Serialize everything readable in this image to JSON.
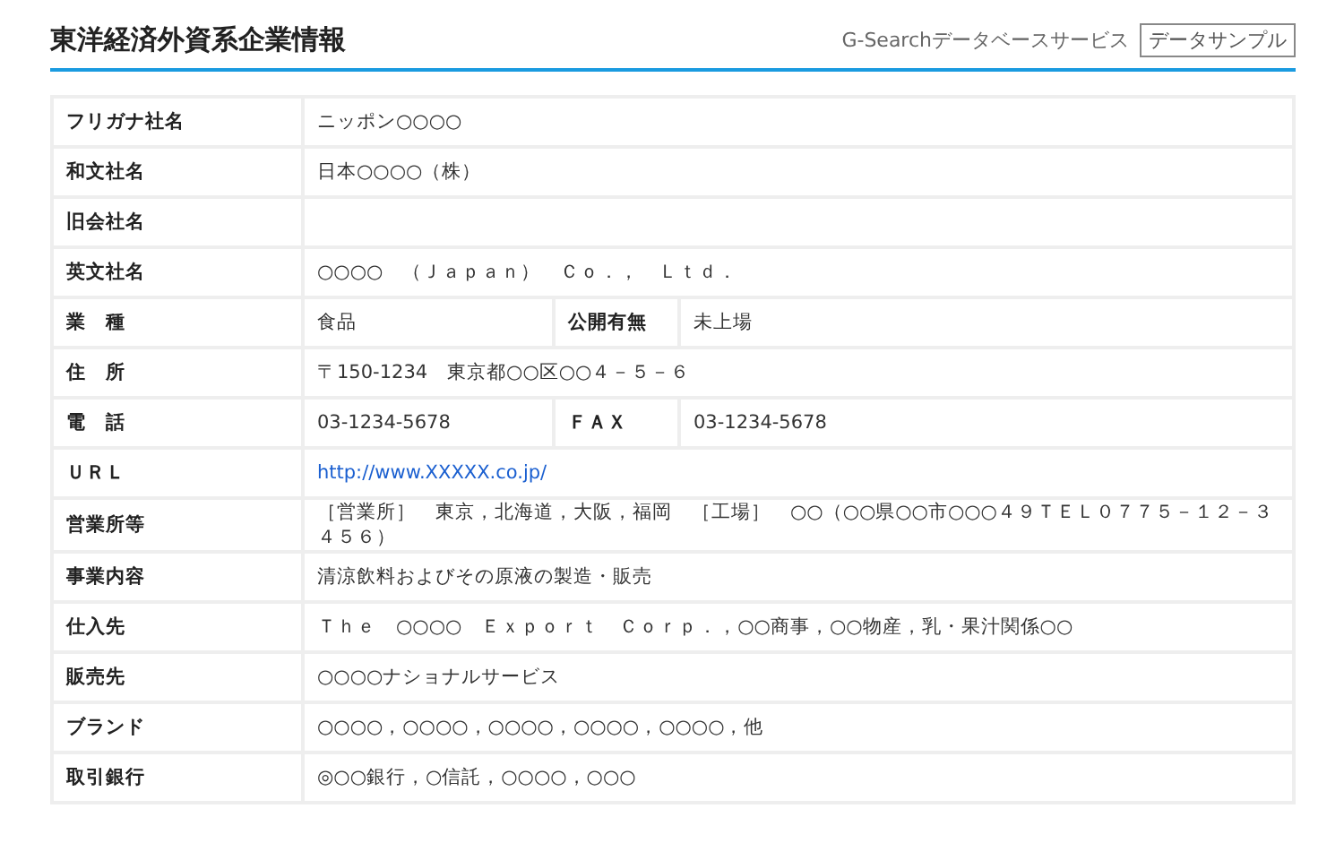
{
  "header": {
    "title": "東洋経済外資系企業情報",
    "service": "G-Searchデータベースサービス",
    "badge": "データサンプル"
  },
  "rows": [
    {
      "kind": "single",
      "label": "フリガナ社名",
      "value": "ニッポン○○○○"
    },
    {
      "kind": "single",
      "label": "和文社名",
      "value": "日本○○○○（株）"
    },
    {
      "kind": "single",
      "label": "旧会社名"
    },
    {
      "kind": "single",
      "label": "英文社名",
      "value": "○○○○　（Ｊａｐａｎ）　Ｃｏ．，　Ｌｔｄ．"
    },
    {
      "kind": "split",
      "label": "業　種",
      "value": "食品",
      "label2": "公開有無",
      "value2": "未上場"
    },
    {
      "kind": "single",
      "label": "住　所",
      "value": "〒150-1234　東京都○○区○○４－５－６"
    },
    {
      "kind": "split",
      "label": "電　話",
      "value": "03-1234-5678",
      "label2": "ＦＡＸ",
      "value2": "03-1234-5678"
    },
    {
      "kind": "link",
      "label": "ＵＲＬ",
      "value": "http://www.XXXXX.co.jp/"
    },
    {
      "kind": "single",
      "label": "営業所等",
      "value": "［営業所］　東京，北海道，大阪，福岡　［工場］　○○（○○県○○市○○○４９ＴＥＬ０７７５－１２－３４５６）"
    },
    {
      "kind": "single",
      "label": "事業内容",
      "value": "清涼飲料およびその原液の製造・販売"
    },
    {
      "kind": "single",
      "label": "仕入先",
      "value": "Ｔｈｅ　○○○○　Ｅｘｐｏｒｔ　Ｃｏｒｐ．，○○商事，○○物産，乳・果汁関係○○"
    },
    {
      "kind": "single",
      "label": "販売先",
      "value": "○○○○ナショナルサービス"
    },
    {
      "kind": "single",
      "label": "ブランド",
      "value": "○○○○，○○○○，○○○○，○○○○，○○○○，他"
    },
    {
      "kind": "single",
      "label": "取引銀行",
      "value": "◎○○銀行，○信託，○○○○，○○○"
    }
  ]
}
